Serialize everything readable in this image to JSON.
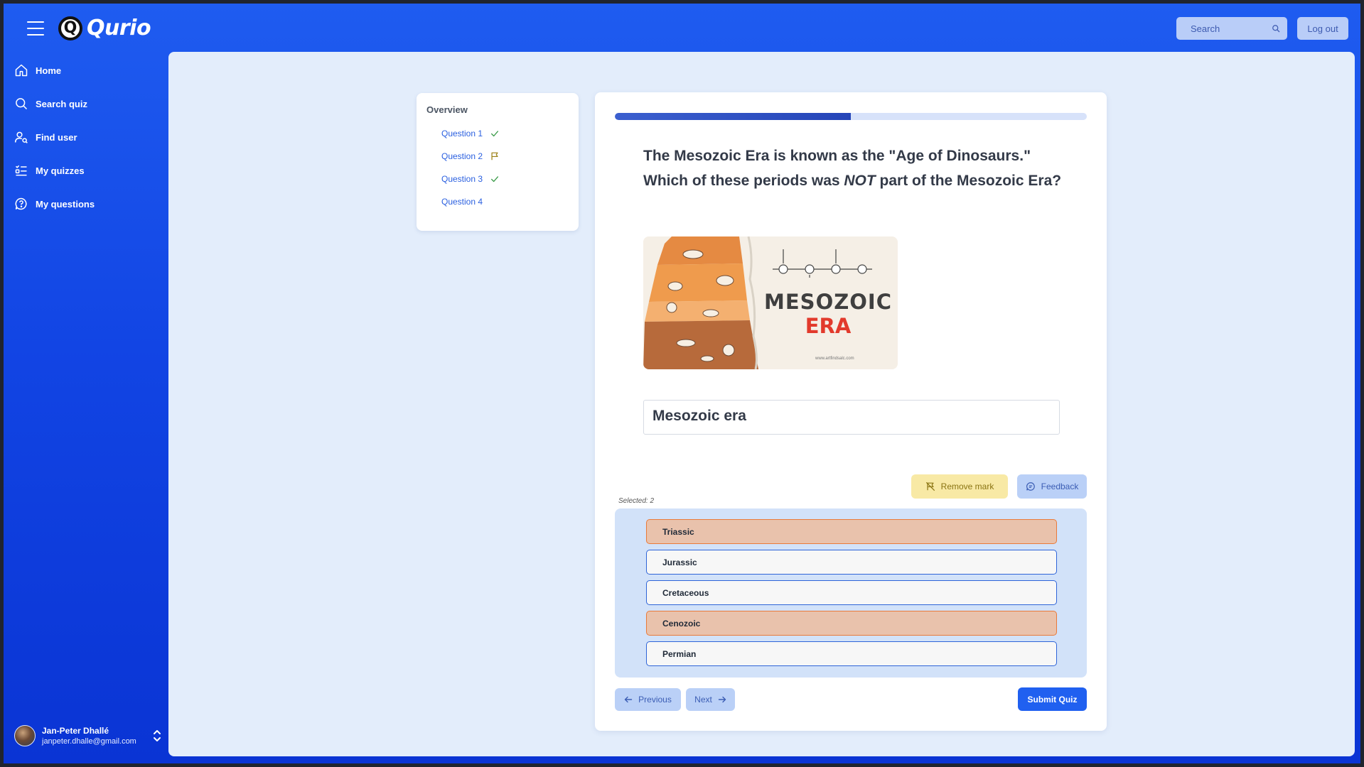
{
  "header": {
    "app_name": "Qurio",
    "logo_letter": "Q",
    "search_placeholder": "Search",
    "logout_label": "Log out"
  },
  "sidebar": {
    "items": [
      {
        "label": "Home",
        "icon": "home-icon"
      },
      {
        "label": "Search quiz",
        "icon": "search-icon"
      },
      {
        "label": "Find user",
        "icon": "user-search-icon"
      },
      {
        "label": "My quizzes",
        "icon": "list-check-icon"
      },
      {
        "label": "My questions",
        "icon": "question-bubble-icon"
      }
    ],
    "user": {
      "name": "Jan-Peter Dhallé",
      "email": "janpeter.dhalle@gmail.com"
    }
  },
  "overview": {
    "title": "Overview",
    "questions": [
      {
        "label": "Question 1",
        "status": "answered",
        "icon": "check-icon"
      },
      {
        "label": "Question 2",
        "status": "flagged",
        "icon": "flag-icon"
      },
      {
        "label": "Question 3",
        "status": "answered",
        "icon": "check-icon"
      },
      {
        "label": "Question 4",
        "status": "none",
        "icon": ""
      }
    ]
  },
  "quiz": {
    "progress_percent": 50,
    "question_part1": "The Mesozoic Era is known as the \"Age of Dinosaurs.\" Which of these periods was ",
    "question_emphasis": "NOT",
    "question_part2": " part of the Mesozoic Era?",
    "image": {
      "title_line1": "MESOZOIC",
      "title_line2": "ERA",
      "url_text": "www.artfindsalc.com"
    },
    "caption": "Mesozoic era",
    "remove_mark_label": "Remove mark",
    "feedback_label": "Feedback",
    "selected_text": "Selected: 2",
    "answers": [
      {
        "label": "Triassic",
        "selected": true
      },
      {
        "label": "Jurassic",
        "selected": false
      },
      {
        "label": "Cretaceous",
        "selected": false
      },
      {
        "label": "Cenozoic",
        "selected": true
      },
      {
        "label": "Permian",
        "selected": false
      }
    ],
    "previous_label": "Previous",
    "next_label": "Next",
    "submit_label": "Submit Quiz"
  },
  "colors": {
    "accent": "#2060f0",
    "selected_answer": "#e9c2ac",
    "flag": "#8a7412"
  }
}
